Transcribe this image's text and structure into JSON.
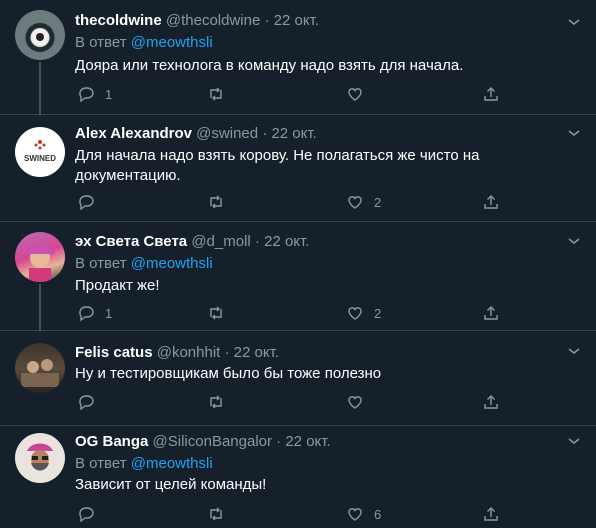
{
  "colors": {
    "background": "#15202b",
    "accent": "#1da1f2",
    "muted": "#8899a6",
    "divider": "#38444d",
    "thread_line": "#3d5466"
  },
  "tweets": [
    {
      "name": "thecoldwine",
      "handle": "@thecoldwine",
      "dot": "·",
      "date": "22 окт.",
      "reply_prefix": "В ответ",
      "reply_to": "@meowthsli",
      "text": "Дояра или технолога в команду надо взять для начала.",
      "replies": "1",
      "retweets": "",
      "likes": ""
    },
    {
      "name": "Alex Alexandrov",
      "handle": "@swined",
      "dot": "·",
      "date": "22 окт.",
      "reply_prefix": "",
      "reply_to": "",
      "text": "Для начала надо взять корову. Не полагаться же чисто на документацию.",
      "replies": "",
      "retweets": "",
      "likes": "2",
      "avatar_text": "SWINED"
    },
    {
      "name": "эх Света Света",
      "handle": "@d_moll",
      "dot": "·",
      "date": "22 окт.",
      "reply_prefix": "В ответ",
      "reply_to": "@meowthsli",
      "text": "Продакт же!",
      "replies": "1",
      "retweets": "",
      "likes": "2"
    },
    {
      "name": "Felis catus",
      "handle": "@konhhit",
      "dot": "·",
      "date": "22 окт.",
      "reply_prefix": "",
      "reply_to": "",
      "text": "Ну и тестировщикам было бы тоже полезно",
      "replies": "",
      "retweets": "",
      "likes": ""
    },
    {
      "name": "OG Banga",
      "handle": "@SiliconBangalor",
      "dot": "·",
      "date": "22 окт.",
      "reply_prefix": "В ответ",
      "reply_to": "@meowthsli",
      "text": "Зависит от целей команды!",
      "replies": "",
      "retweets": "",
      "likes": "6"
    }
  ],
  "icons": {
    "reply": "reply-icon",
    "retweet": "retweet-icon",
    "like": "heart-icon",
    "share": "share-icon",
    "more": "chevron-down-icon"
  }
}
